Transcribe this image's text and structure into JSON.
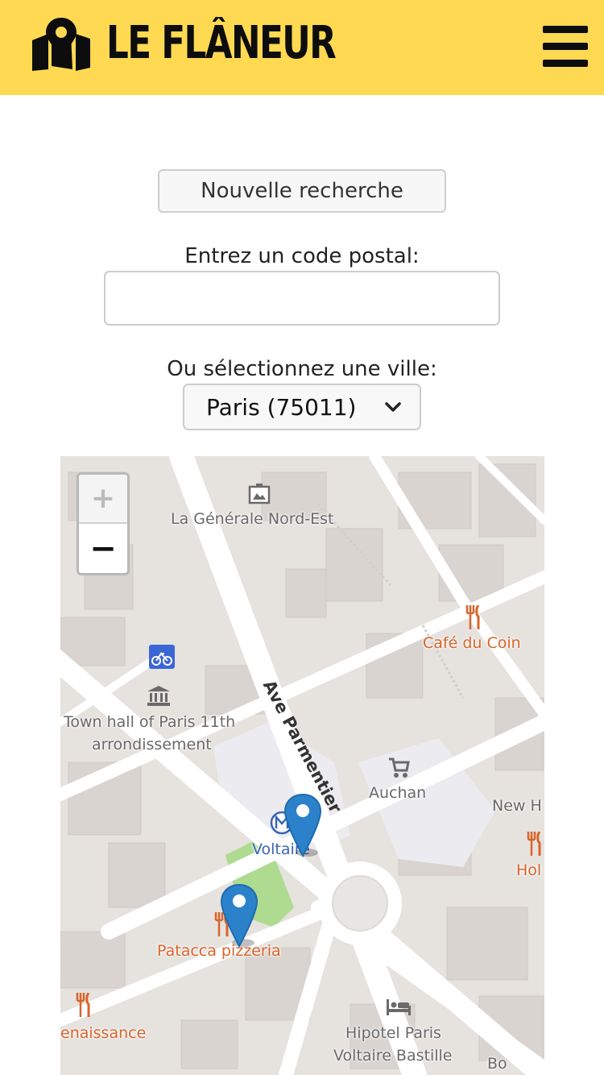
{
  "header": {
    "brand": "LE FLÂNEUR",
    "logo_icon": "map-pin-icon",
    "menu_icon": "hamburger-menu-icon",
    "background": "#ffd952"
  },
  "form": {
    "new_search_label": "Nouvelle recherche",
    "postal_label": "Entrez un code postal:",
    "postal_value": "",
    "city_label": "Ou sélectionnez une ville:",
    "city_selected": "Paris (75011)"
  },
  "map": {
    "zoom_in": "+",
    "zoom_out": "−",
    "labels": {
      "generale": "La Générale Nord-Est",
      "cafe": "Café du Coin",
      "townhall_1": "Town hall of Paris 11th",
      "townhall_2": "arrondissement",
      "avenue": "Ave Parmentier",
      "auchan": "Auchan",
      "newh": "New H",
      "hol": "Hol",
      "voltaire": "Voltaire",
      "patacca": "Patacca pizzeria",
      "renaissance": "enaissance",
      "hipotel_1": "Hipotel Paris",
      "hipotel_2": "Voltaire Bastille",
      "bo": "Bo"
    },
    "markers": [
      "map-marker-icon",
      "map-marker-icon"
    ]
  }
}
